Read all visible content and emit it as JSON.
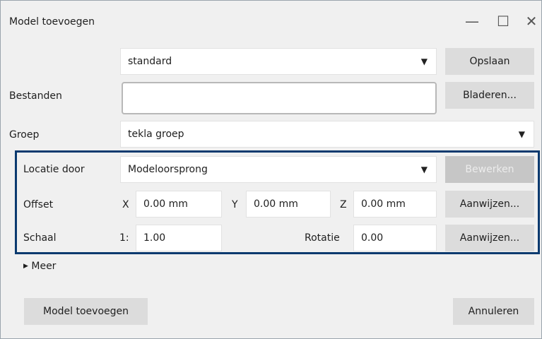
{
  "window": {
    "title": "Model toevoegen",
    "minimize_glyph": "—",
    "maximize_glyph": "☐",
    "close_glyph": "✕"
  },
  "settings_select": {
    "value": "standard"
  },
  "save_button": "Opslaan",
  "files": {
    "label": "Bestanden",
    "value": "",
    "browse_button": "Bladeren..."
  },
  "group": {
    "label": "Groep",
    "value": "tekla groep"
  },
  "location": {
    "label": "Locatie door",
    "value": "Modeloorsprong",
    "edit_button": "Bewerken"
  },
  "offset": {
    "label": "Offset",
    "x_label": "X",
    "x_value": "0.00 mm",
    "y_label": "Y",
    "y_value": "0.00 mm",
    "z_label": "Z",
    "z_value": "0.00 mm",
    "pick_button": "Aanwijzen..."
  },
  "scale": {
    "label": "Schaal",
    "prefix": "1:",
    "value": "1.00",
    "rotation_label": "Rotatie",
    "rotation_value": "0.00",
    "pick_button": "Aanwijzen..."
  },
  "more": {
    "label": "Meer"
  },
  "footer": {
    "add_button": "Model toevoegen",
    "cancel_button": "Annuleren"
  },
  "colors": {
    "highlight_border": "#0b3a6f",
    "dialog_bg": "#f0f0f0",
    "button_bg": "#dcdcdc",
    "disabled_button_bg": "#c6c6c6"
  },
  "icons": {
    "dropdown": "caret-down-icon",
    "more": "caret-right-icon"
  }
}
